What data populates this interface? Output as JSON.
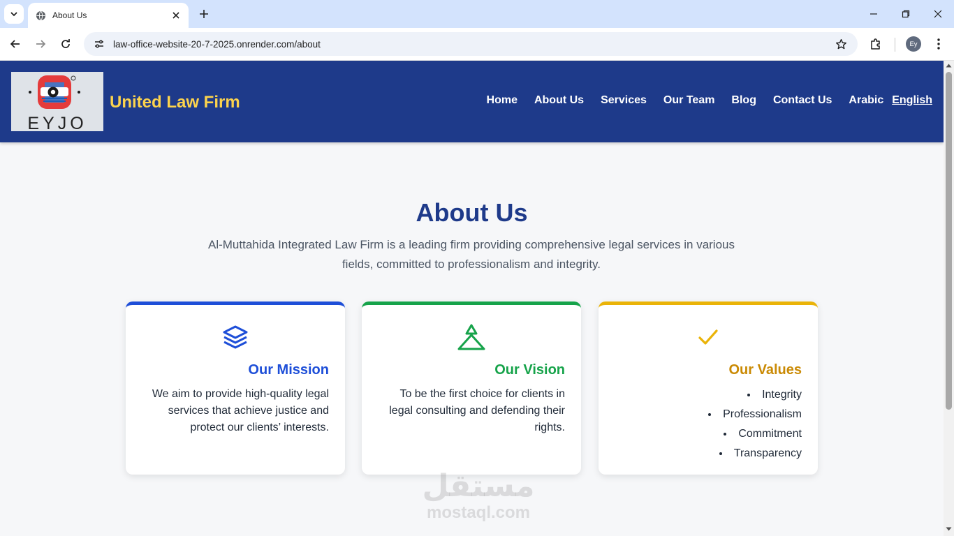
{
  "browser": {
    "tab_title": "About Us",
    "url": "law-office-website-20-7-2025.onrender.com/about",
    "profile_initials": "Ey"
  },
  "header": {
    "logo_text": "EYJO",
    "site_name": "United Law Firm",
    "nav": [
      "Home",
      "About Us",
      "Services",
      "Our Team",
      "Blog",
      "Contact Us"
    ],
    "lang_arabic": "Arabic",
    "lang_english": "English"
  },
  "about": {
    "title": "About Us",
    "description": "Al-Muttahida Integrated Law Firm is a leading firm providing comprehensive legal services in various fields, committed to professionalism and integrity."
  },
  "cards": [
    {
      "title": "Our Mission",
      "icon": "layers-icon",
      "accent": "#1d4ed8",
      "text": "We aim to provide high-quality legal services that achieve justice and protect our clients’ interests."
    },
    {
      "title": "Our Vision",
      "icon": "triangle-icon",
      "accent": "#16a34a",
      "text": "To be the first choice for clients in legal consulting and defending their rights."
    },
    {
      "title": "Our Values",
      "icon": "check-icon",
      "accent": "#eab308",
      "values": [
        "Integrity",
        "Professionalism",
        "Commitment",
        "Transparency"
      ]
    }
  ],
  "watermark": {
    "arabic": "مستقل",
    "latin": "mostaql.com"
  }
}
